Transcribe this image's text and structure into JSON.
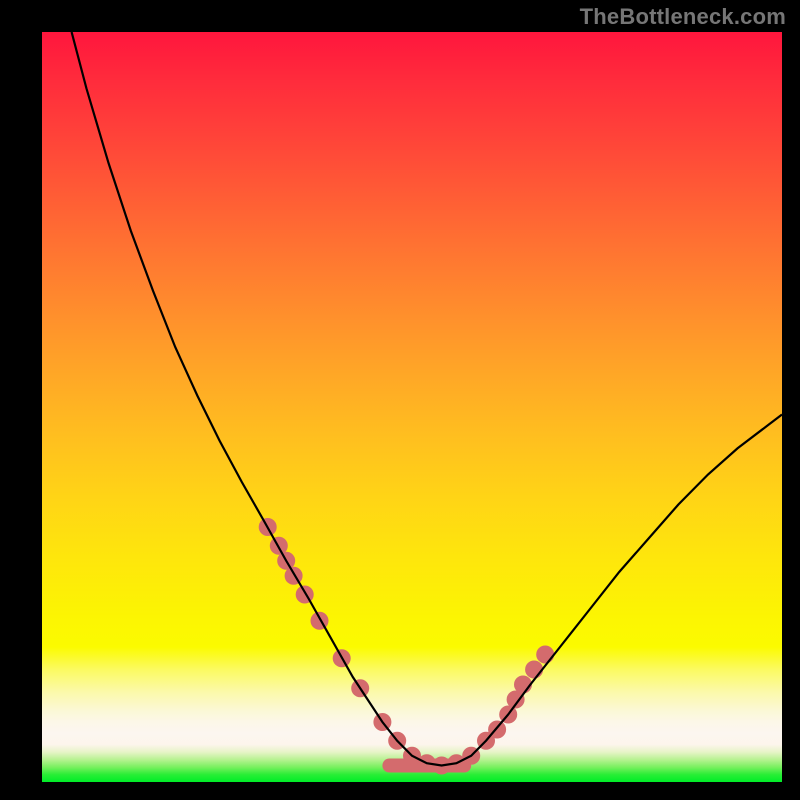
{
  "attribution": "TheBottleneck.com",
  "chart_data": {
    "type": "line",
    "title": "",
    "xlabel": "",
    "ylabel": "",
    "xlim": [
      0,
      100
    ],
    "ylim": [
      0,
      100
    ],
    "series": [
      {
        "name": "curve",
        "color": "#000000",
        "stroke_width": 2.2,
        "x": [
          4,
          6,
          9,
          12,
          15,
          18,
          21,
          24,
          27,
          30,
          33,
          36,
          38,
          40,
          42,
          44,
          46,
          48,
          50,
          52,
          54,
          56,
          58,
          60,
          63,
          66,
          70,
          74,
          78,
          82,
          86,
          90,
          94,
          98,
          100
        ],
        "values": [
          100,
          92.5,
          82.5,
          73.5,
          65.5,
          58,
          51.5,
          45.5,
          40,
          34.8,
          29.5,
          24.5,
          21,
          17.5,
          14,
          11,
          8,
          5.5,
          3.5,
          2.5,
          2.2,
          2.5,
          3.5,
          5.5,
          9,
          13,
          18,
          23,
          28,
          32.5,
          37,
          41,
          44.5,
          47.5,
          49
        ]
      }
    ],
    "markers": {
      "name": "highlight-dots",
      "color": "#d46b6d",
      "radius": 9,
      "x": [
        30.5,
        32,
        33,
        34,
        35.5,
        37.5,
        40.5,
        43,
        46,
        48,
        50,
        52,
        54,
        56,
        58,
        60,
        61.5,
        63,
        64,
        65,
        66.5,
        68
      ],
      "values": [
        34,
        31.5,
        29.5,
        27.5,
        25,
        21.5,
        16.5,
        12.5,
        8,
        5.5,
        3.5,
        2.5,
        2.2,
        2.5,
        3.5,
        5.5,
        7,
        9,
        11,
        13,
        15,
        17
      ]
    },
    "valley_bar": {
      "name": "valley-bar",
      "color": "#d46b6d",
      "x_start": 46,
      "x_end": 58,
      "y": 2.2,
      "thickness": 14
    }
  }
}
